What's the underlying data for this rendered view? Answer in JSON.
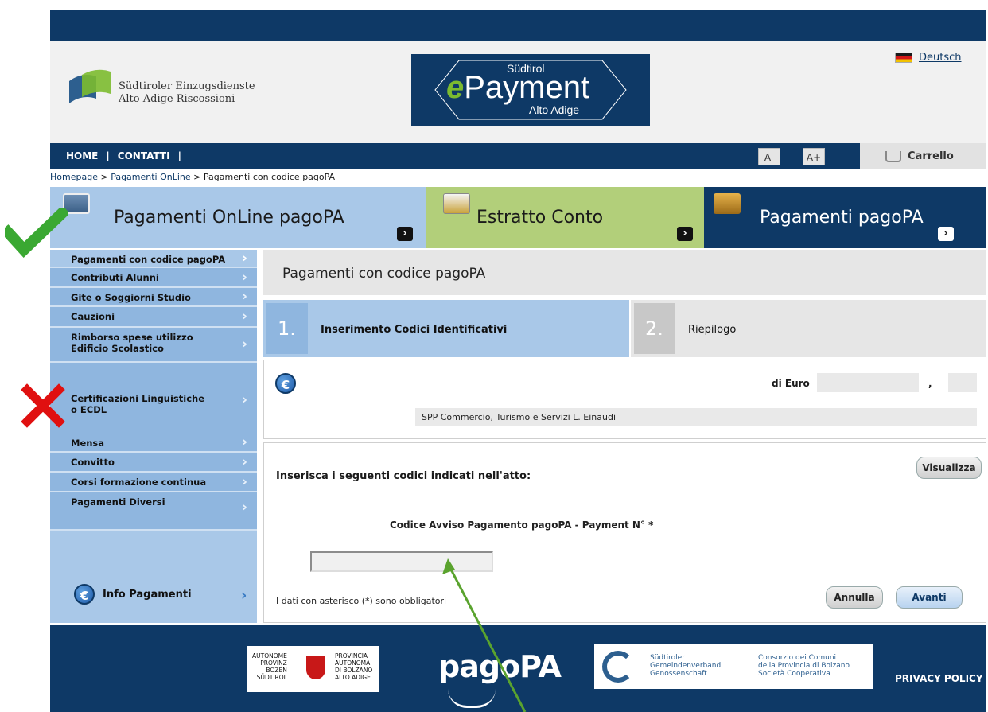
{
  "header": {
    "org_line1": "Südtiroler Einzugsdienste",
    "org_line2": "Alto Adige Riscossioni",
    "epayment_top": "Südtirol",
    "epayment_e": "e",
    "epayment_main": "Payment",
    "epayment_bottom": "Alto Adige",
    "language_link": "Deutsch"
  },
  "nav": {
    "home": "HOME",
    "contatti": "CONTATTI",
    "font_smaller": "A-",
    "font_larger": "A+",
    "cart": "Carrello"
  },
  "breadcrumb": {
    "items": [
      "Homepage",
      "Pagamenti OnLine",
      "Pagamenti con codice pagoPA"
    ],
    "separator": ">"
  },
  "tabs": [
    {
      "label": "Pagamenti OnLine pagoPA"
    },
    {
      "label": "Estratto Conto"
    },
    {
      "label": "Pagamenti pagoPA"
    }
  ],
  "sidebar": {
    "items": [
      {
        "label": "Pagamenti con codice pagoPA"
      },
      {
        "label": "Contributi Alunni"
      },
      {
        "label": "Gite o Soggiorni Studio"
      },
      {
        "label": "Cauzioni"
      },
      {
        "label": "Rimborso spese utilizzo Edificio Scolastico"
      },
      {
        "label": "Certificazioni Linguistiche o ECDL"
      },
      {
        "label": "Mensa"
      },
      {
        "label": "Convitto"
      },
      {
        "label": "Corsi formazione continua"
      },
      {
        "label": "Pagamenti Diversi"
      }
    ],
    "info_label": "Info Pagamenti"
  },
  "main": {
    "title": "Pagamenti con codice pagoPA",
    "steps": [
      {
        "number": "1.",
        "label": "Inserimento Codici Identificativi"
      },
      {
        "number": "2.",
        "label": "Riepilogo"
      }
    ],
    "amount_label": "di Euro",
    "amount_integer": "",
    "amount_comma": ",",
    "amount_decimal": "",
    "school_name": "SPP Commercio, Turismo e Servizi L. Einaudi",
    "form_heading": "Inserisca i seguenti codici indicati nell'atto:",
    "view_button": "Visualizza",
    "code_label": "Codice Avviso Pagamento pagoPA - Payment N° *",
    "code_value": "",
    "required_note": "I dati con asterisco (*) sono obbligatori",
    "cancel_button": "Annulla",
    "next_button": "Avanti"
  },
  "footer": {
    "province_left": [
      "AUTONOME",
      "PROVINZ",
      "BOZEN",
      "SÜDTIROL"
    ],
    "province_right": [
      "PROVINCIA",
      "AUTONOMA",
      "DI BOLZANO",
      "ALTO ADIGE"
    ],
    "pagopa": "pagoPA",
    "consorzio_left": [
      "Südtiroler",
      "Gemeindenverband",
      "Genossenschaft"
    ],
    "consorzio_right": [
      "Consorzio dei Comuni",
      "della Provincia di Bolzano",
      "Società Cooperativa"
    ],
    "privacy": "PRIVACY POLICY"
  },
  "colors": {
    "navy": "#0e3966",
    "light_blue": "#a9c8e8",
    "green_tab": "#b2cf7a",
    "annotation_green": "#3aa832",
    "annotation_red": "#e01010"
  }
}
